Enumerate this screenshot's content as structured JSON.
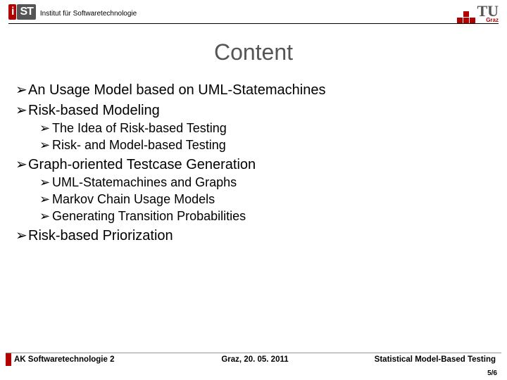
{
  "header": {
    "institute": "Institut für Softwaretechnologie",
    "logo_i": "i",
    "logo_st": "ST",
    "tu": "TU",
    "tu_city": "Graz"
  },
  "title": "Content",
  "bullets": {
    "b1": "An Usage Model based on UML-Statemachines",
    "b2": "Risk-based Modeling",
    "b2_1": "The Idea of Risk-based Testing",
    "b2_2": "Risk- and Model-based Testing",
    "b3": "Graph-oriented Testcase Generation",
    "b3_1": "UML-Statemachines and Graphs",
    "b3_2": "Markov Chain Usage Models",
    "b3_3": "Generating Transition Probabilities",
    "b4": "Risk-based Priorization"
  },
  "footer": {
    "left": "AK Softwaretechnologie 2",
    "mid": "Graz, 20. 05. 2011",
    "right": "Statistical Model-Based Testing",
    "page": "5/6"
  },
  "glyph": "➢"
}
